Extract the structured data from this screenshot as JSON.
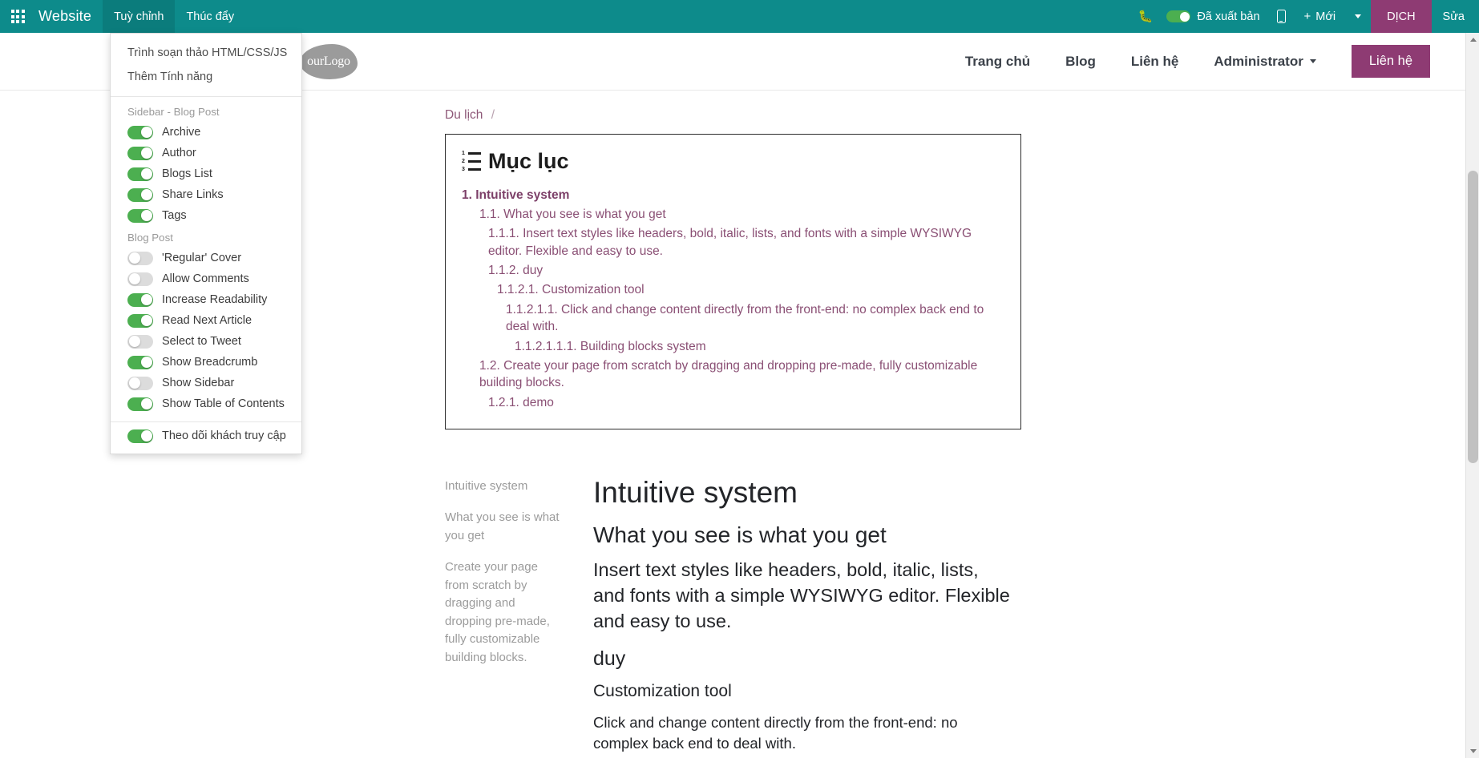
{
  "topbar": {
    "apps_icon": "apps-grid-icon",
    "brand": "Website",
    "menus": [
      {
        "label": "Tuỳ chỉnh",
        "active": true
      },
      {
        "label": "Thúc đẩy",
        "active": false
      }
    ],
    "bug_icon": "bug-icon",
    "publish_label": "Đã xuất bản",
    "publish_on": true,
    "mobile_icon": "mobile-preview-icon",
    "new_label": "Mới",
    "new_icon": "plus-icon",
    "caret_icon": "chevron-down-icon",
    "user_label": "DỊCH",
    "edit_label": "Sửa",
    "accent_teal": "#0d8b8b",
    "accent_purple": "#8e3b73",
    "toggle_green": "#4caf50"
  },
  "customize_dropdown": {
    "links": [
      "Trình soạn thảo HTML/CSS/JS",
      "Thêm Tính năng"
    ],
    "groups": [
      {
        "header": "Sidebar - Blog Post",
        "items": [
          {
            "label": "Archive",
            "on": true
          },
          {
            "label": "Author",
            "on": true
          },
          {
            "label": "Blogs List",
            "on": true
          },
          {
            "label": "Share Links",
            "on": true
          },
          {
            "label": "Tags",
            "on": true
          }
        ]
      },
      {
        "header": "Blog Post",
        "items": [
          {
            "label": "'Regular' Cover",
            "on": false
          },
          {
            "label": "Allow Comments",
            "on": false
          },
          {
            "label": "Increase Readability",
            "on": true
          },
          {
            "label": "Read Next Article",
            "on": true
          },
          {
            "label": "Select to Tweet",
            "on": false
          },
          {
            "label": "Show Breadcrumb",
            "on": true
          },
          {
            "label": "Show Sidebar",
            "on": false
          },
          {
            "label": "Show Table of Contents",
            "on": true
          }
        ]
      },
      {
        "header": "",
        "items": [
          {
            "label": "Theo dõi khách truy cập",
            "on": true
          }
        ]
      }
    ]
  },
  "site_header": {
    "logo_text": "ourLogo",
    "nav": [
      {
        "label": "Trang chủ",
        "dropdown": false
      },
      {
        "label": "Blog",
        "dropdown": false
      },
      {
        "label": "Liên hệ",
        "dropdown": false
      },
      {
        "label": "Administrator",
        "dropdown": true
      }
    ],
    "cta_label": "Liên hệ"
  },
  "breadcrumb": {
    "items": [
      "Du lịch"
    ],
    "separator": "/"
  },
  "toc": {
    "title": "Mục lục",
    "icon": "ordered-list-icon",
    "entries": [
      {
        "number": "1.",
        "text": "Intuitive system",
        "level": 1
      },
      {
        "number": "1.1.",
        "text": "What you see is what you get",
        "level": 2
      },
      {
        "number": "1.1.1.",
        "text": "Insert text styles like headers, bold, italic, lists, and fonts with a simple WYSIWYG editor. Flexible and easy to use.",
        "level": 3
      },
      {
        "number": "1.1.2.",
        "text": "duy",
        "level": 3
      },
      {
        "number": "1.1.2.1.",
        "text": "Customization tool",
        "level": 4
      },
      {
        "number": "1.1.2.1.1.",
        "text": "Click and change content directly from the front-end: no complex back end to deal with.",
        "level": 5
      },
      {
        "number": "1.1.2.1.1.1.",
        "text": "Building blocks system",
        "level": 6
      },
      {
        "number": "1.2.",
        "text": "Create your page from scratch by dragging and dropping pre-made, fully customizable building blocks.",
        "level": 2
      },
      {
        "number": "1.2.1.",
        "text": "demo",
        "level": 3
      }
    ]
  },
  "article": {
    "side_items": [
      "Intuitive system",
      "What you see is what you get",
      "Create your page from scratch by dragging and dropping pre-made, fully customizable building blocks."
    ],
    "blocks": [
      {
        "level": 1,
        "text": "Intuitive system"
      },
      {
        "level": 2,
        "text": "What you see is what you get"
      },
      {
        "level": 3,
        "text": "Insert text styles like headers, bold, italic, lists, and fonts with a simple WYSIWYG editor. Flexible and easy to use."
      },
      {
        "level": 4,
        "text": "duy"
      },
      {
        "level": 5,
        "text": "Customization tool"
      },
      {
        "level": 6,
        "text": "Click and change content directly from the front-end: no complex back end to deal with."
      }
    ]
  },
  "scrollbar": {
    "up_icon": "scroll-up-arrow-icon",
    "down_icon": "scroll-down-arrow-icon"
  }
}
